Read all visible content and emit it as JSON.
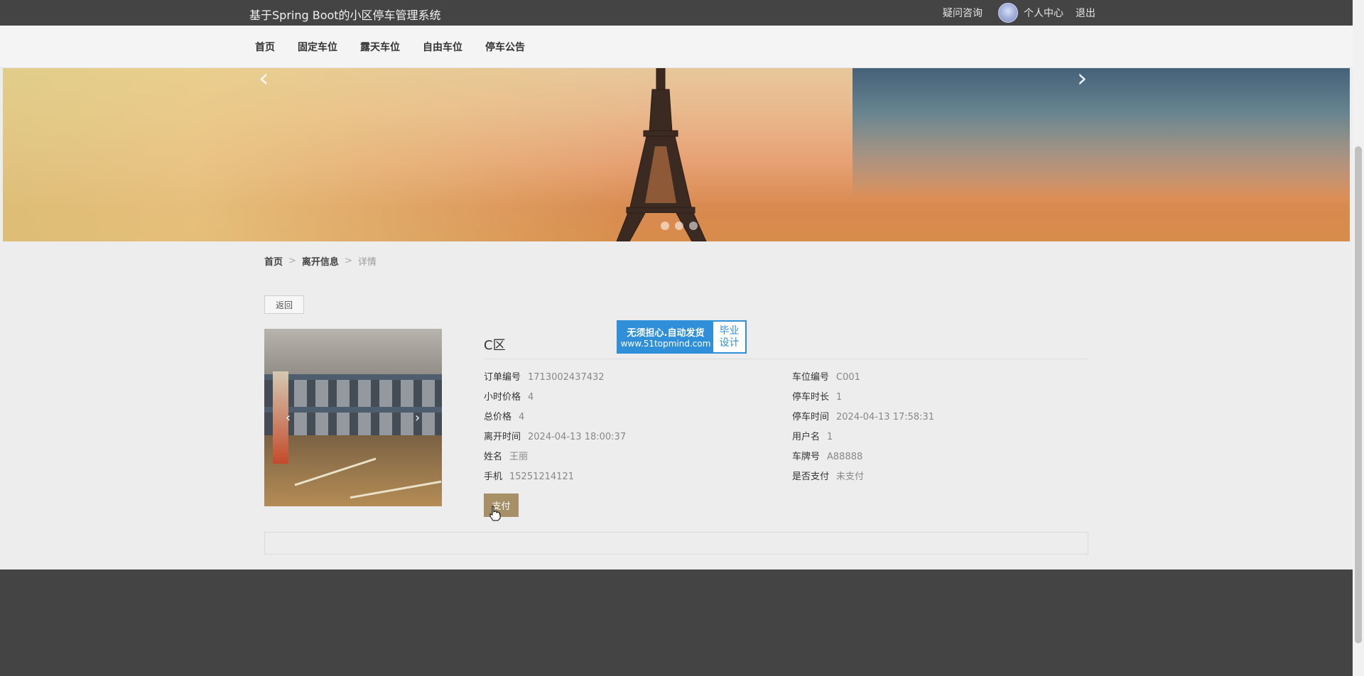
{
  "header": {
    "site_title": "基于Spring Boot的小区停车管理系统",
    "consult_link": "疑问咨询",
    "profile_link": "个人中心",
    "logout_link": "退出"
  },
  "nav": {
    "items": [
      {
        "label": "首页"
      },
      {
        "label": "固定车位"
      },
      {
        "label": "露天车位"
      },
      {
        "label": "自由车位"
      },
      {
        "label": "停车公告"
      }
    ]
  },
  "banner": {
    "slide_count": 3,
    "active_slide": 1
  },
  "breadcrumb": {
    "home": "首页",
    "section": "离开信息",
    "current": "详情",
    "separator": ">"
  },
  "back_button": "返回",
  "detail": {
    "title": "C区",
    "left_fields": [
      {
        "label": "订单编号",
        "value": "1713002437432"
      },
      {
        "label": "小时价格",
        "value": "4"
      },
      {
        "label": "总价格",
        "value": "4"
      },
      {
        "label": "离开时间",
        "value": "2024-04-13 18:00:37"
      },
      {
        "label": "姓名",
        "value": "王丽"
      },
      {
        "label": "手机",
        "value": "15251214121"
      }
    ],
    "right_fields": [
      {
        "label": "车位编号",
        "value": "C001"
      },
      {
        "label": "停车时长",
        "value": "1"
      },
      {
        "label": "停车时间",
        "value": "2024-04-13 17:58:31"
      },
      {
        "label": "用户名",
        "value": "1"
      },
      {
        "label": "车牌号",
        "value": "A88888"
      },
      {
        "label": "是否支付",
        "value": "未支付"
      }
    ],
    "pay_button": "支付"
  },
  "watermark": {
    "line1": "无须担心.自动发货",
    "line2": "www.51topmind.com",
    "right_line1": "毕业",
    "right_line2": "设计"
  },
  "colors": {
    "topbar": "#444444",
    "pay_button": "#a79068",
    "watermark_blue": "#2f8fd8"
  }
}
